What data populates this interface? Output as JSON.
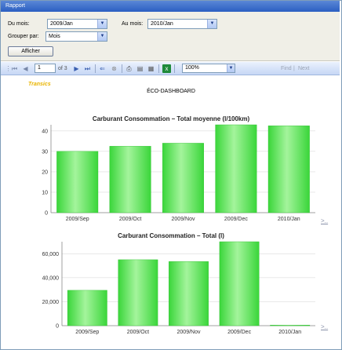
{
  "window": {
    "title": "Rapport"
  },
  "filters": {
    "from_label": "Du mois:",
    "from_value": "2009/Jan",
    "to_label": "Au mois:",
    "to_value": "2010/Jan",
    "group_label": "Grouper par:",
    "group_value": "Mois",
    "submit_label": "Afficher"
  },
  "toolbar": {
    "page_value": "1",
    "page_of": "of 3",
    "zoom_value": "100%",
    "find_label": "Find",
    "find_sep": "|",
    "next_label": "Next"
  },
  "report": {
    "brand": "Transics",
    "title": "ÉCO-DASHBOARD",
    "more_link_1": ">..",
    "more_link_2": ">.."
  },
  "colors": {
    "bar": "#3ad63a",
    "bar_light": "#a4f49c",
    "titlebar": "#2b5fc2"
  },
  "chart_data": [
    {
      "type": "bar",
      "title": "Carburant Consommation – Total moyenne (l/100km)",
      "categories": [
        "2009/Sep",
        "2009/Oct",
        "2009/Nov",
        "2009/Dec",
        "2010/Jan"
      ],
      "values": [
        30,
        32.5,
        34,
        43,
        42.5
      ],
      "ylim": [
        0,
        43
      ],
      "yticks": [
        "0",
        "10",
        "20",
        "30",
        "40"
      ],
      "grid": true
    },
    {
      "type": "bar",
      "title": "Carburant Consommation – Total (l)",
      "categories": [
        "2009/Sep",
        "2009/Oct",
        "2009/Nov",
        "2009/Dec",
        "2010/Jan"
      ],
      "values": [
        29500,
        55000,
        53500,
        70000,
        500
      ],
      "ylim": [
        0,
        70000
      ],
      "yticks": [
        "0",
        "20,000",
        "40,000",
        "60,000"
      ],
      "grid": true
    }
  ]
}
